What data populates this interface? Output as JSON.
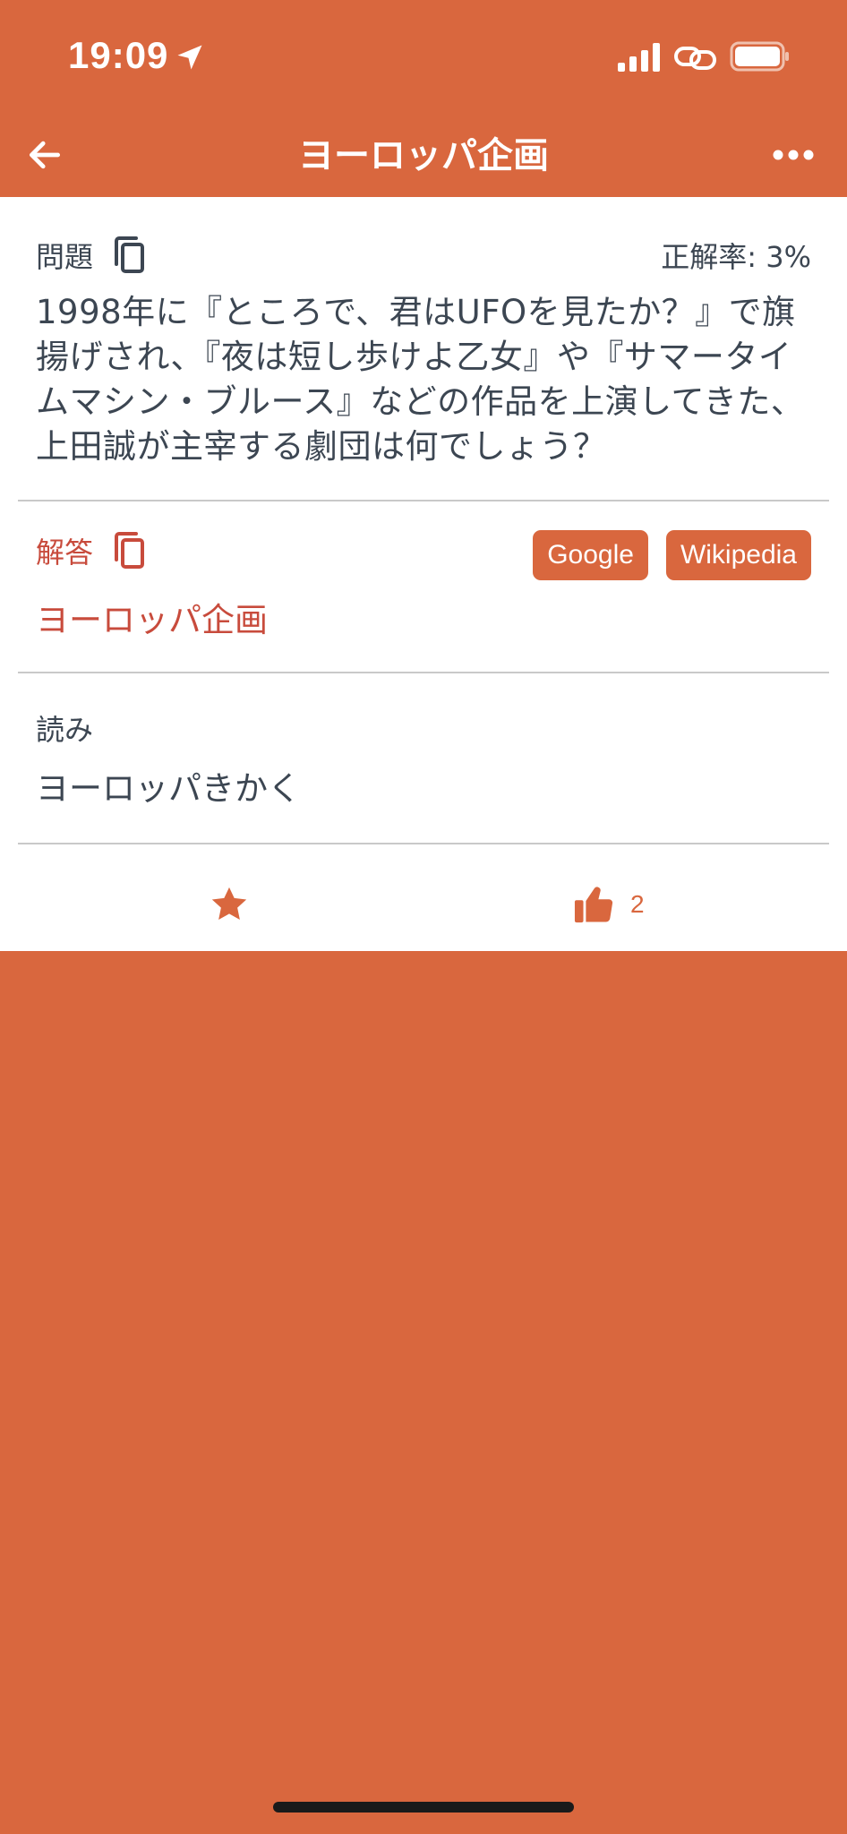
{
  "status_bar": {
    "time": "19:09",
    "icons": [
      "location-arrow-icon",
      "signal-icon",
      "link-icon",
      "battery-icon"
    ]
  },
  "nav": {
    "title": "ヨーロッパ企画",
    "back_icon": "arrow-left-icon",
    "more_icon": "ellipsis-icon"
  },
  "question": {
    "label": "問題",
    "correct_rate": "正解率: 3%",
    "text": "1998年に『ところで、君はUFOを見たか？』で旗揚げされ、『夜は短し歩けよ乙女』や『サマータイムマシン・ブルース』などの作品を上演してきた、上田誠が主宰する劇団は何でしょう？"
  },
  "answer": {
    "label": "解答",
    "text": "ヨーロッパ企画",
    "buttons": [
      "Google",
      "Wikipedia"
    ]
  },
  "reading": {
    "label": "読み",
    "text": "ヨーロッパきかく"
  },
  "actions": {
    "favorite_icon": "star-icon",
    "like_icon": "thumbs-up-icon",
    "like_count": "2"
  },
  "colors": {
    "accent": "#d9673e",
    "answer_red": "#c84b3c",
    "text_dark": "#3c4652"
  }
}
